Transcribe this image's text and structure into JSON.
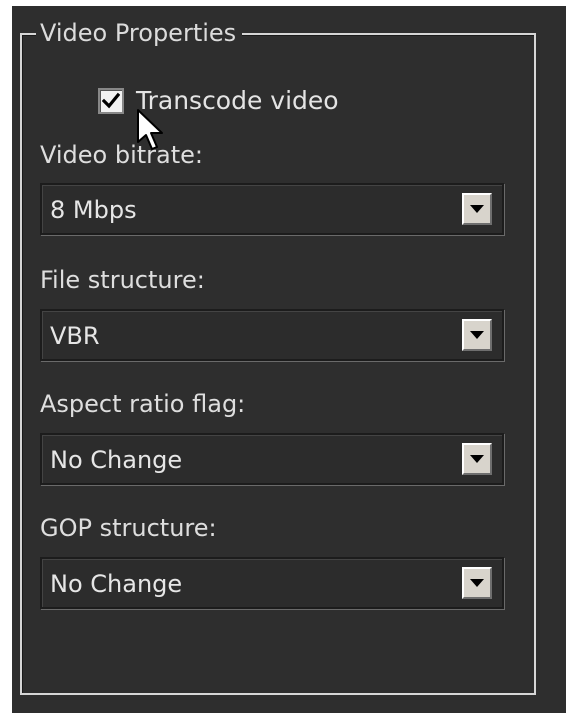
{
  "group": {
    "title": "Video Properties"
  },
  "transcode": {
    "label": "Transcode video",
    "checked": true
  },
  "fields": [
    {
      "label": "Video bitrate:",
      "value": "8 Mbps"
    },
    {
      "label": "File structure:",
      "value": "VBR"
    },
    {
      "label": "Aspect ratio flag:",
      "value": "No Change"
    },
    {
      "label": "GOP structure:",
      "value": "No Change"
    }
  ],
  "icons": {
    "checkbox": "check-icon",
    "dropdown": "dropdown-arrow-icon",
    "cursor": "mouse-pointer-icon"
  },
  "colors": {
    "panel_bg": "#2e2e2e",
    "text": "#e0e0e0",
    "frame": "#d6d6d6",
    "button_face": "#d8d4cc"
  }
}
